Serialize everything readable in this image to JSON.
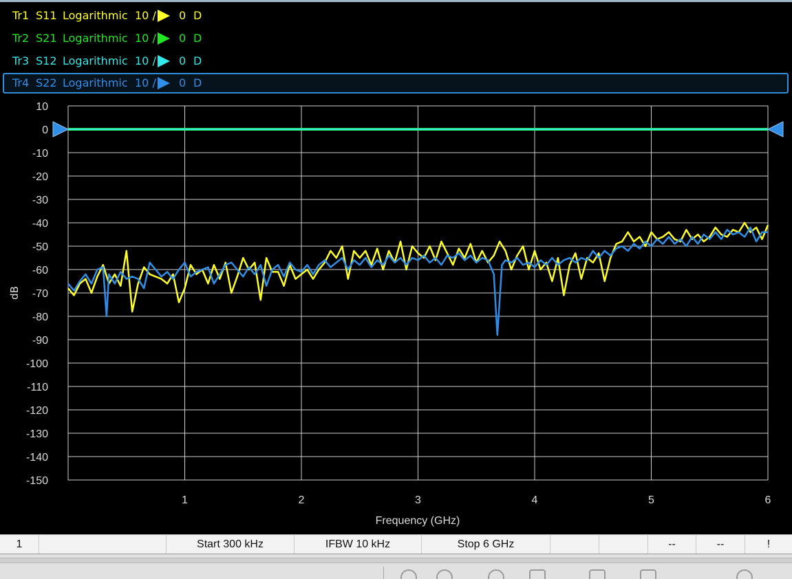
{
  "traces": [
    {
      "id": "Tr1",
      "param": "S11",
      "format": "Logarithmic",
      "scale": "10 /",
      "ref": "0",
      "flag": "D",
      "color": "#ffff2a",
      "active": false
    },
    {
      "id": "Tr2",
      "param": "S21",
      "format": "Logarithmic",
      "scale": "10 /",
      "ref": "0",
      "flag": "D",
      "color": "#22e622",
      "active": false
    },
    {
      "id": "Tr3",
      "param": "S12",
      "format": "Logarithmic",
      "scale": "10 /",
      "ref": "0",
      "flag": "D",
      "color": "#33e8e8",
      "active": false
    },
    {
      "id": "Tr4",
      "param": "S22",
      "format": "Logarithmic",
      "scale": "10 /",
      "ref": "0",
      "flag": "D",
      "color": "#2f8fe8",
      "active": true
    }
  ],
  "status": {
    "channel": "1",
    "start": "Start 300 kHz",
    "ifbw": "IFBW 10 kHz",
    "stop": "Stop 6 GHz",
    "field1": "--",
    "field2": "--",
    "alert": "!"
  },
  "chart_data": {
    "type": "line",
    "xlabel": "Frequency (GHz)",
    "ylabel": "dB",
    "xlim": [
      0,
      6
    ],
    "ylim": [
      -150,
      10
    ],
    "x_ticks": [
      1,
      2,
      3,
      4,
      5,
      6
    ],
    "y_ticks": [
      10,
      0,
      -10,
      -20,
      -30,
      -40,
      -50,
      -60,
      -70,
      -80,
      -90,
      -100,
      -110,
      -120,
      -130,
      -140,
      -150
    ],
    "grid": true,
    "reference_level": 0,
    "colors": {
      "Tr1": "#ffff2a",
      "Tr2": "#22e622",
      "Tr3": "#33e8e8",
      "Tr4": "#2f8fe8",
      "grid": "#d0d0d0"
    },
    "series": [
      {
        "name": "Tr1",
        "values": [
          [
            0.0,
            -68
          ],
          [
            0.05,
            -71
          ],
          [
            0.1,
            -66
          ],
          [
            0.15,
            -64
          ],
          [
            0.2,
            -70
          ],
          [
            0.25,
            -63
          ],
          [
            0.3,
            -58
          ],
          [
            0.35,
            -66
          ],
          [
            0.4,
            -62
          ],
          [
            0.45,
            -67
          ],
          [
            0.5,
            -52
          ],
          [
            0.55,
            -78
          ],
          [
            0.6,
            -66
          ],
          [
            0.65,
            -59
          ],
          [
            0.7,
            -62
          ],
          [
            0.75,
            -63
          ],
          [
            0.8,
            -64
          ],
          [
            0.85,
            -66
          ],
          [
            0.9,
            -62
          ],
          [
            0.95,
            -74
          ],
          [
            1.0,
            -68
          ],
          [
            1.05,
            -58
          ],
          [
            1.1,
            -62
          ],
          [
            1.15,
            -60
          ],
          [
            1.2,
            -66
          ],
          [
            1.25,
            -58
          ],
          [
            1.3,
            -64
          ],
          [
            1.35,
            -57
          ],
          [
            1.4,
            -70
          ],
          [
            1.45,
            -63
          ],
          [
            1.5,
            -55
          ],
          [
            1.55,
            -60
          ],
          [
            1.6,
            -57
          ],
          [
            1.65,
            -73
          ],
          [
            1.7,
            -55
          ],
          [
            1.75,
            -61
          ],
          [
            1.8,
            -61
          ],
          [
            1.85,
            -67
          ],
          [
            1.9,
            -58
          ],
          [
            1.95,
            -64
          ],
          [
            2.0,
            -62
          ],
          [
            2.05,
            -60
          ],
          [
            2.1,
            -64
          ],
          [
            2.15,
            -60
          ],
          [
            2.2,
            -57
          ],
          [
            2.25,
            -52
          ],
          [
            2.3,
            -55
          ],
          [
            2.35,
            -50
          ],
          [
            2.4,
            -64
          ],
          [
            2.45,
            -52
          ],
          [
            2.5,
            -55
          ],
          [
            2.55,
            -52
          ],
          [
            2.6,
            -58
          ],
          [
            2.65,
            -51
          ],
          [
            2.7,
            -60
          ],
          [
            2.75,
            -52
          ],
          [
            2.8,
            -57
          ],
          [
            2.85,
            -48
          ],
          [
            2.9,
            -60
          ],
          [
            2.95,
            -50
          ],
          [
            3.0,
            -53
          ],
          [
            3.05,
            -55
          ],
          [
            3.1,
            -50
          ],
          [
            3.15,
            -56
          ],
          [
            3.2,
            -48
          ],
          [
            3.25,
            -53
          ],
          [
            3.3,
            -58
          ],
          [
            3.35,
            -51
          ],
          [
            3.4,
            -55
          ],
          [
            3.45,
            -49
          ],
          [
            3.5,
            -57
          ],
          [
            3.55,
            -52
          ],
          [
            3.6,
            -57
          ],
          [
            3.65,
            -54
          ],
          [
            3.7,
            -48
          ],
          [
            3.75,
            -52
          ],
          [
            3.8,
            -60
          ],
          [
            3.85,
            -54
          ],
          [
            3.9,
            -50
          ],
          [
            3.95,
            -60
          ],
          [
            4.0,
            -52
          ],
          [
            4.05,
            -60
          ],
          [
            4.1,
            -57
          ],
          [
            4.15,
            -65
          ],
          [
            4.2,
            -55
          ],
          [
            4.25,
            -71
          ],
          [
            4.3,
            -58
          ],
          [
            4.35,
            -53
          ],
          [
            4.4,
            -64
          ],
          [
            4.45,
            -55
          ],
          [
            4.5,
            -57
          ],
          [
            4.55,
            -53
          ],
          [
            4.6,
            -65
          ],
          [
            4.65,
            -55
          ],
          [
            4.7,
            -49
          ],
          [
            4.75,
            -48
          ],
          [
            4.8,
            -44
          ],
          [
            4.85,
            -48
          ],
          [
            4.9,
            -46
          ],
          [
            4.95,
            -50
          ],
          [
            5.0,
            -44
          ],
          [
            5.05,
            -47
          ],
          [
            5.1,
            -46
          ],
          [
            5.15,
            -44
          ],
          [
            5.2,
            -47
          ],
          [
            5.25,
            -48
          ],
          [
            5.3,
            -43
          ],
          [
            5.35,
            -47
          ],
          [
            5.4,
            -45
          ],
          [
            5.45,
            -48
          ],
          [
            5.5,
            -46
          ],
          [
            5.55,
            -42
          ],
          [
            5.6,
            -45
          ],
          [
            5.65,
            -46
          ],
          [
            5.7,
            -43
          ],
          [
            5.75,
            -44
          ],
          [
            5.8,
            -40
          ],
          [
            5.85,
            -44
          ],
          [
            5.9,
            -42
          ],
          [
            5.95,
            -47
          ],
          [
            6.0,
            -41
          ]
        ]
      },
      {
        "name": "Tr2",
        "values": [
          [
            0.0,
            0
          ],
          [
            6.0,
            0
          ]
        ]
      },
      {
        "name": "Tr3",
        "values": [
          [
            0.0,
            0
          ],
          [
            6.0,
            0
          ]
        ]
      },
      {
        "name": "Tr4",
        "values": [
          [
            0.0,
            -66
          ],
          [
            0.05,
            -69
          ],
          [
            0.1,
            -65
          ],
          [
            0.15,
            -62
          ],
          [
            0.2,
            -66
          ],
          [
            0.25,
            -60
          ],
          [
            0.3,
            -59
          ],
          [
            0.33,
            -80
          ],
          [
            0.35,
            -62
          ],
          [
            0.4,
            -66
          ],
          [
            0.45,
            -61
          ],
          [
            0.5,
            -64
          ],
          [
            0.55,
            -63
          ],
          [
            0.6,
            -64
          ],
          [
            0.65,
            -68
          ],
          [
            0.7,
            -57
          ],
          [
            0.75,
            -60
          ],
          [
            0.8,
            -63
          ],
          [
            0.85,
            -61
          ],
          [
            0.9,
            -64
          ],
          [
            0.95,
            -60
          ],
          [
            1.0,
            -57
          ],
          [
            1.05,
            -63
          ],
          [
            1.1,
            -61
          ],
          [
            1.15,
            -60
          ],
          [
            1.2,
            -59
          ],
          [
            1.25,
            -66
          ],
          [
            1.3,
            -62
          ],
          [
            1.35,
            -58
          ],
          [
            1.4,
            -57
          ],
          [
            1.45,
            -60
          ],
          [
            1.5,
            -63
          ],
          [
            1.55,
            -59
          ],
          [
            1.6,
            -62
          ],
          [
            1.65,
            -58
          ],
          [
            1.7,
            -67
          ],
          [
            1.75,
            -60
          ],
          [
            1.8,
            -58
          ],
          [
            1.85,
            -63
          ],
          [
            1.9,
            -57
          ],
          [
            1.95,
            -60
          ],
          [
            2.0,
            -61
          ],
          [
            2.05,
            -58
          ],
          [
            2.1,
            -62
          ],
          [
            2.15,
            -58
          ],
          [
            2.2,
            -56
          ],
          [
            2.25,
            -59
          ],
          [
            2.3,
            -57
          ],
          [
            2.35,
            -55
          ],
          [
            2.4,
            -60
          ],
          [
            2.45,
            -56
          ],
          [
            2.5,
            -58
          ],
          [
            2.55,
            -55
          ],
          [
            2.6,
            -59
          ],
          [
            2.65,
            -56
          ],
          [
            2.7,
            -58
          ],
          [
            2.75,
            -54
          ],
          [
            2.8,
            -57
          ],
          [
            2.85,
            -55
          ],
          [
            2.9,
            -58
          ],
          [
            2.95,
            -55
          ],
          [
            3.0,
            -56
          ],
          [
            3.05,
            -54
          ],
          [
            3.1,
            -57
          ],
          [
            3.15,
            -55
          ],
          [
            3.2,
            -58
          ],
          [
            3.25,
            -54
          ],
          [
            3.3,
            -55
          ],
          [
            3.35,
            -53
          ],
          [
            3.4,
            -56
          ],
          [
            3.45,
            -54
          ],
          [
            3.5,
            -57
          ],
          [
            3.55,
            -55
          ],
          [
            3.6,
            -56
          ],
          [
            3.65,
            -62
          ],
          [
            3.68,
            -88
          ],
          [
            3.72,
            -58
          ],
          [
            3.75,
            -56
          ],
          [
            3.8,
            -57
          ],
          [
            3.85,
            -55
          ],
          [
            3.9,
            -58
          ],
          [
            3.95,
            -57
          ],
          [
            4.0,
            -59
          ],
          [
            4.05,
            -56
          ],
          [
            4.1,
            -58
          ],
          [
            4.15,
            -55
          ],
          [
            4.2,
            -58
          ],
          [
            4.25,
            -56
          ],
          [
            4.3,
            -55
          ],
          [
            4.35,
            -57
          ],
          [
            4.4,
            -55
          ],
          [
            4.45,
            -56
          ],
          [
            4.5,
            -52
          ],
          [
            4.55,
            -55
          ],
          [
            4.6,
            -52
          ],
          [
            4.65,
            -54
          ],
          [
            4.7,
            -51
          ],
          [
            4.75,
            -50
          ],
          [
            4.8,
            -52
          ],
          [
            4.85,
            -49
          ],
          [
            4.9,
            -51
          ],
          [
            4.95,
            -48
          ],
          [
            5.0,
            -50
          ],
          [
            5.05,
            -47
          ],
          [
            5.1,
            -49
          ],
          [
            5.15,
            -46
          ],
          [
            5.2,
            -49
          ],
          [
            5.25,
            -47
          ],
          [
            5.3,
            -50
          ],
          [
            5.35,
            -46
          ],
          [
            5.4,
            -49
          ],
          [
            5.45,
            -45
          ],
          [
            5.5,
            -47
          ],
          [
            5.55,
            -44
          ],
          [
            5.6,
            -47
          ],
          [
            5.65,
            -43
          ],
          [
            5.7,
            -45
          ],
          [
            5.75,
            -44
          ],
          [
            5.8,
            -46
          ],
          [
            5.85,
            -42
          ],
          [
            5.9,
            -48
          ],
          [
            5.95,
            -44
          ],
          [
            6.0,
            -44
          ]
        ]
      }
    ]
  }
}
